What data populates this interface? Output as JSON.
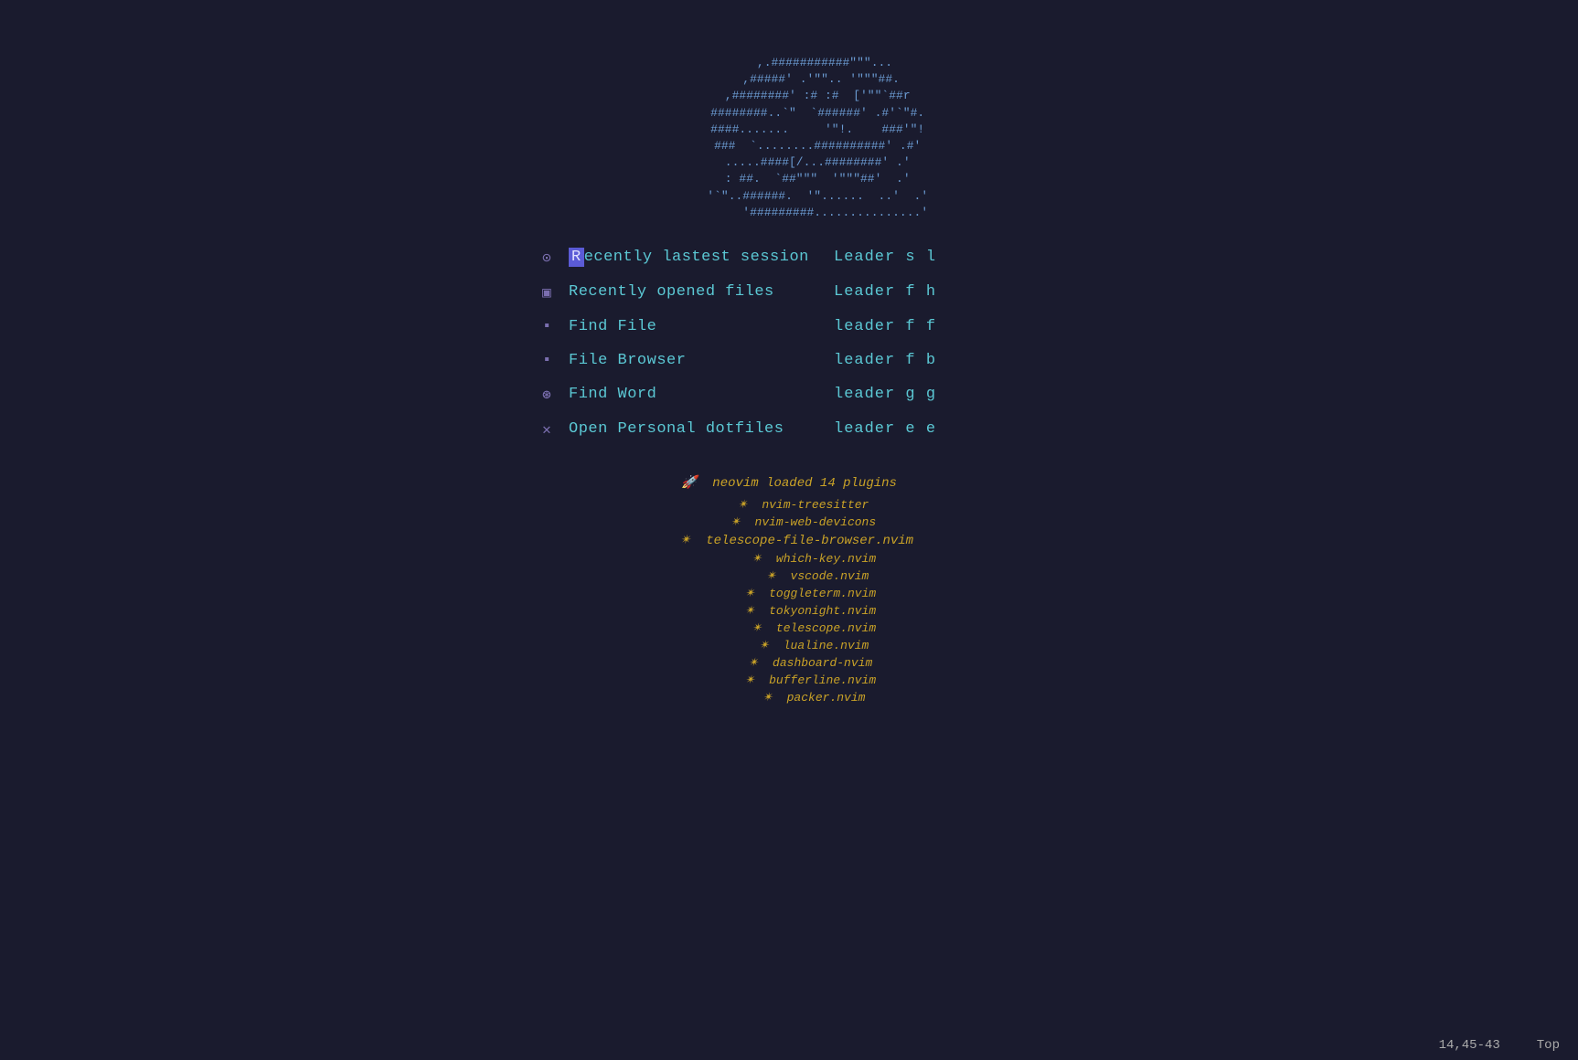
{
  "ascii_art": {
    "lines": [
      "          ,.###########\"\"\"...",
      "         ,#####' .'\"\".. '\"\"\"##.",
      "        ,########' :# :#  ['\"\"`##r",
      "        ########..'\"  '######' .#'`\"#.",
      "        ####.......     '\"!.    ###'\"!",
      "        ###  '........##########' .#'",
      "        .....####[/...########' .'",
      "        : ##.  '##\"\"\"  '\"\"\"##'  .'",
      "        '`\"..######.  '\"......  ..'  .'",
      "             '#########...............'"
    ]
  },
  "menu": {
    "items": [
      {
        "icon": "⊙",
        "label": "Recently lastest session",
        "shortcut": "Leader s l",
        "highlighted": true
      },
      {
        "icon": "▣",
        "label": "Recently opened files",
        "shortcut": "Leader f h",
        "highlighted": false
      },
      {
        "icon": "▪",
        "label": "Find File",
        "shortcut": "leader f f",
        "highlighted": false
      },
      {
        "icon": "▪",
        "label": "File Browser",
        "shortcut": "leader f b",
        "highlighted": false
      },
      {
        "icon": "⊛",
        "label": "Find Word",
        "shortcut": "leader g g",
        "highlighted": false
      },
      {
        "icon": "✕",
        "label": "Open Personal dotfiles",
        "shortcut": "leader e e",
        "highlighted": false
      }
    ]
  },
  "plugins": {
    "title": "🚀  neovim loaded 14 plugins",
    "items": [
      {
        "icon": "✴",
        "name": "nvim-treesitter",
        "size": "small"
      },
      {
        "icon": "✴",
        "name": "nvim-web-devicons",
        "size": "small"
      },
      {
        "icon": "✴",
        "name": "telescope-file-browser.nvim",
        "size": "large"
      },
      {
        "icon": "✴",
        "name": "which-key.nvim",
        "size": "small"
      },
      {
        "icon": "✴",
        "name": "vscode.nvim",
        "size": "small"
      },
      {
        "icon": "✴",
        "name": "toggleterm.nvim",
        "size": "small"
      },
      {
        "icon": "✴",
        "name": "tokyonight.nvim",
        "size": "small"
      },
      {
        "icon": "✴",
        "name": "telescope.nvim",
        "size": "small"
      },
      {
        "icon": "✴",
        "name": "lualine.nvim",
        "size": "small"
      },
      {
        "icon": "✴",
        "name": "dashboard-nvim",
        "size": "small"
      },
      {
        "icon": "✴",
        "name": "bufferline.nvim",
        "size": "small"
      },
      {
        "icon": "✴",
        "name": "packer.nvim",
        "size": "small"
      }
    ]
  },
  "statusbar": {
    "position": "14,45-43",
    "scroll": "Top"
  }
}
